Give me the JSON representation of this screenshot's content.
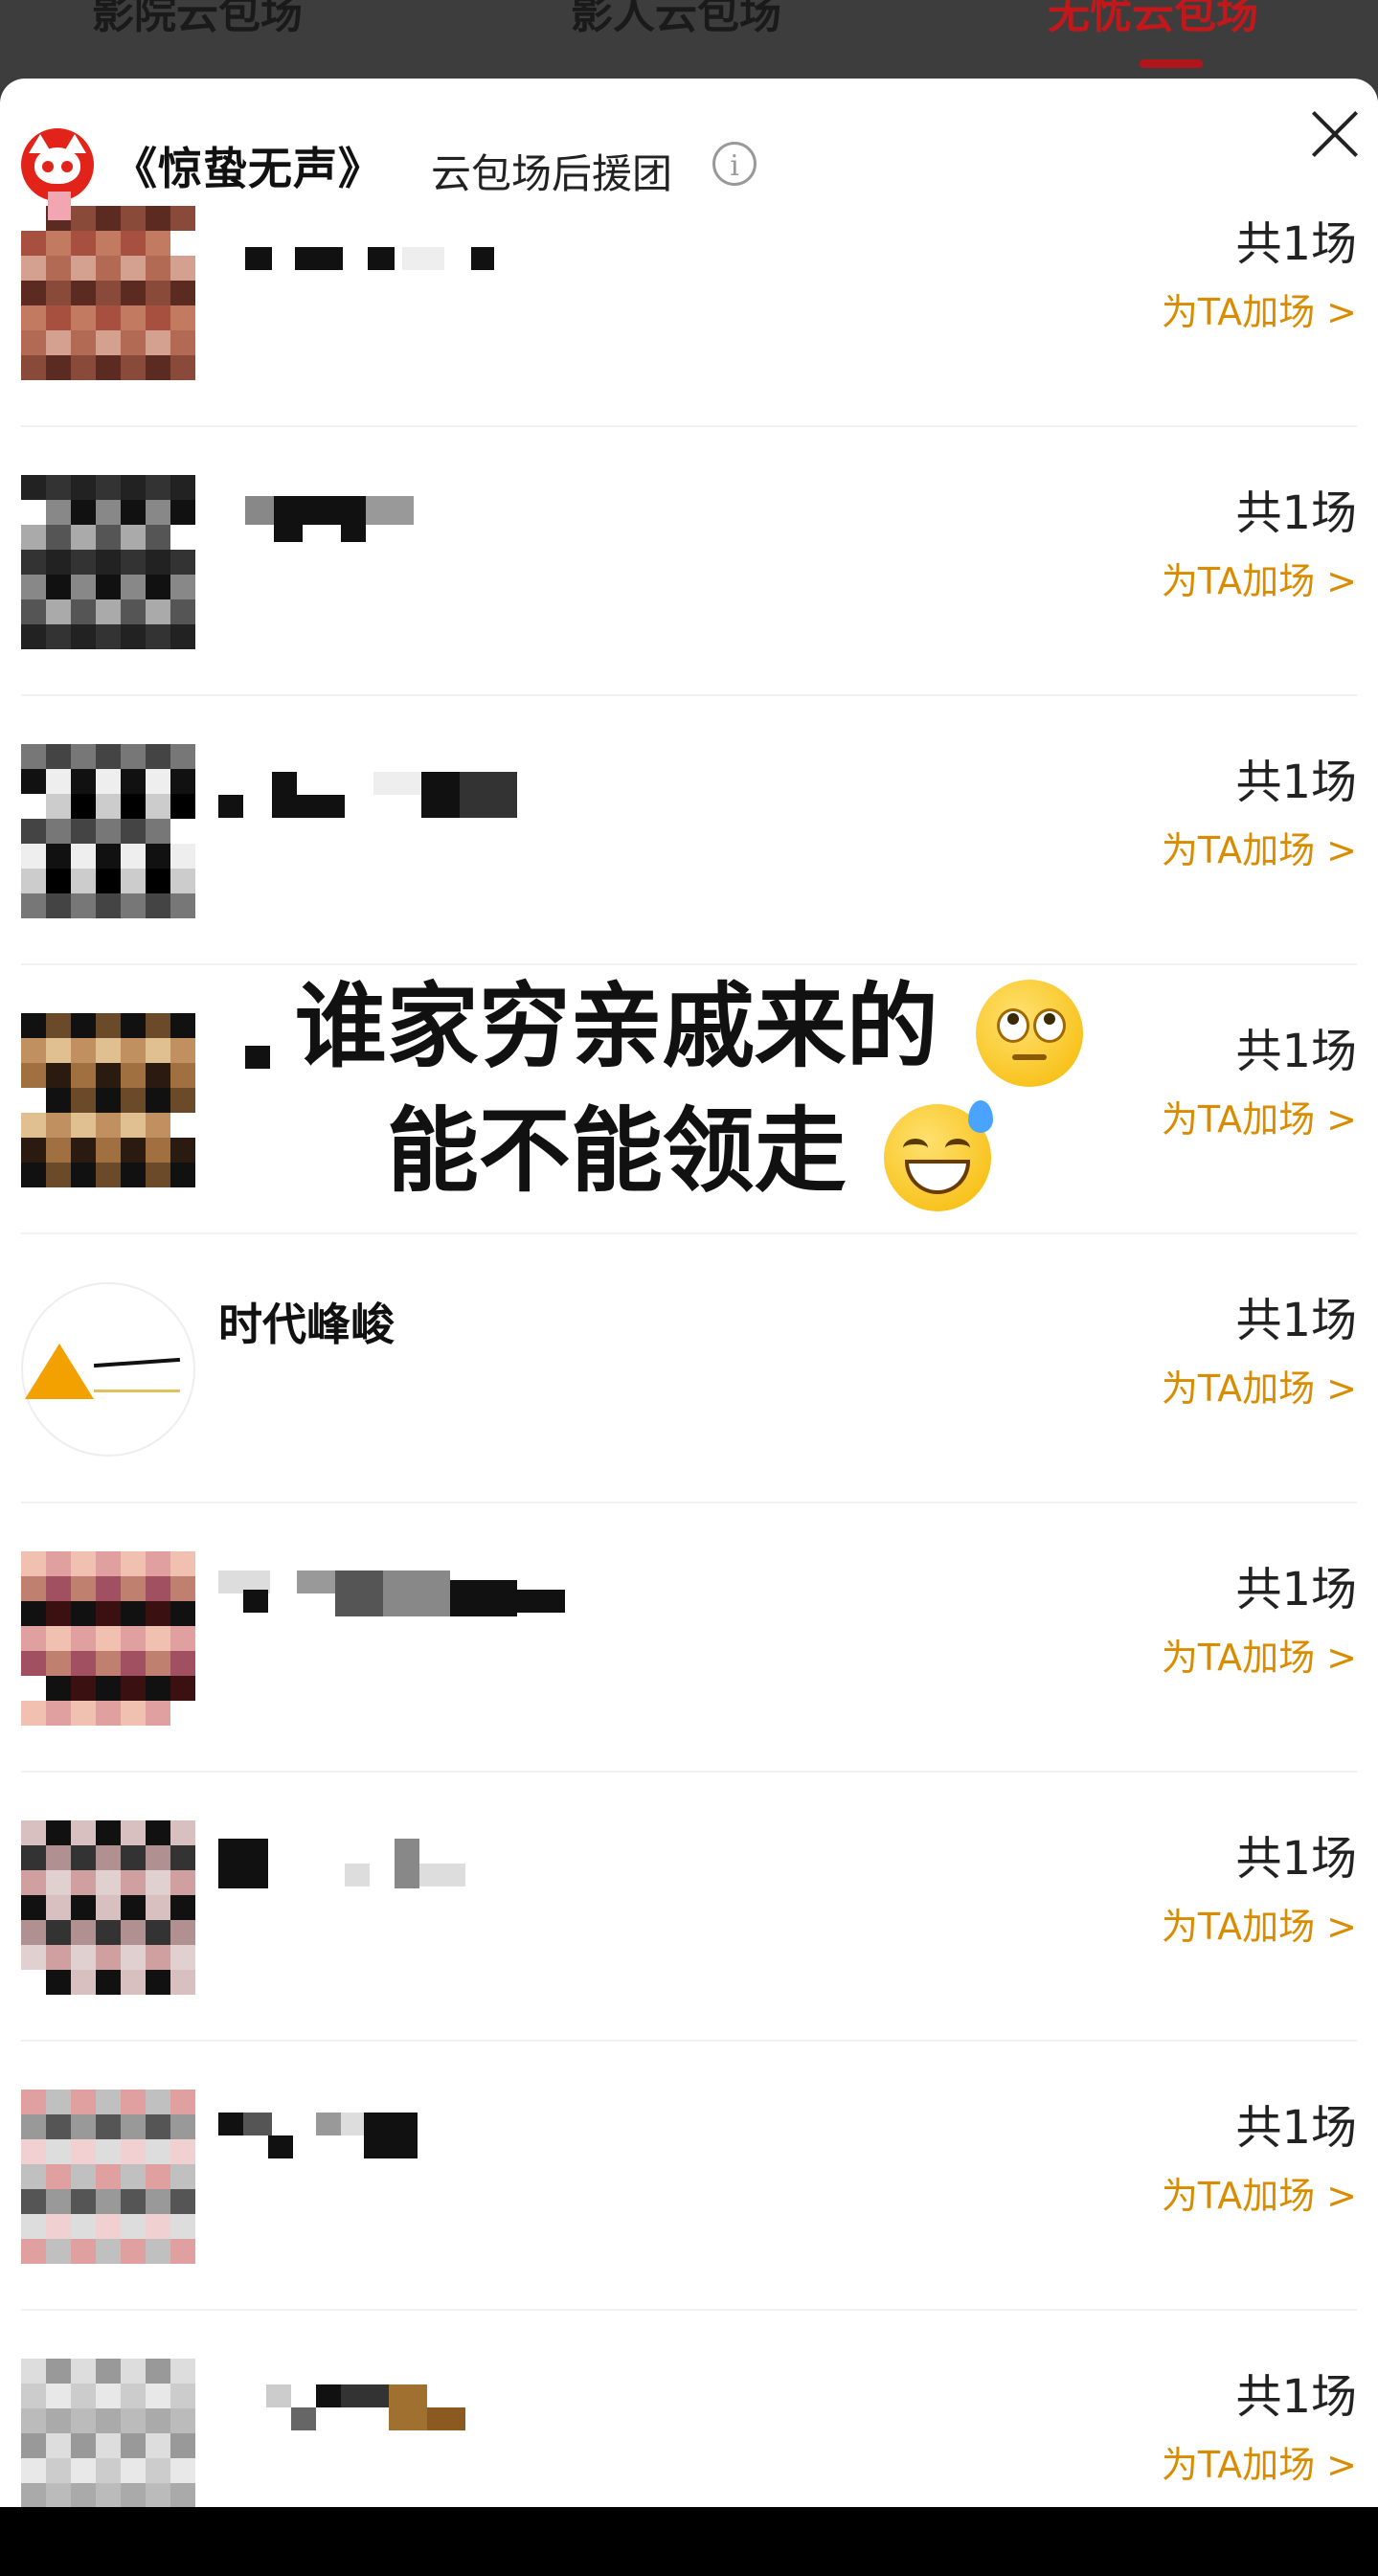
{
  "top_tabs": [
    {
      "label": "影院云包场",
      "active": false
    },
    {
      "label": "影人云包场",
      "active": false
    },
    {
      "label": "无忧云包场",
      "active": true
    }
  ],
  "sheet": {
    "title": "《惊蛰无声》",
    "subtitle": "云包场后援团",
    "info_icon": "info-icon",
    "close_icon": "close-icon"
  },
  "rows": [
    {
      "name": "",
      "count": "共1场",
      "action": "为TA加场 >",
      "avatar": "pixelated"
    },
    {
      "name": "",
      "count": "共1场",
      "action": "为TA加场 >",
      "avatar": "pixelated"
    },
    {
      "name": "",
      "count": "共1场",
      "action": "为TA加场 >",
      "avatar": "pixelated"
    },
    {
      "name": "",
      "count": "共1场",
      "action": "为TA加场 >",
      "avatar": "pixelated"
    },
    {
      "name": "时代峰峻",
      "count": "共1场",
      "action": "为TA加场 >",
      "avatar": "logo"
    },
    {
      "name": "",
      "count": "共1场",
      "action": "为TA加场 >",
      "avatar": "pixelated"
    },
    {
      "name": "",
      "count": "共1场",
      "action": "为TA加场 >",
      "avatar": "pixelated"
    },
    {
      "name": "",
      "count": "共1场",
      "action": "为TA加场 >",
      "avatar": "pixelated"
    },
    {
      "name": "",
      "count": "共1场",
      "action": "为TA加场 >",
      "avatar": "pixelated"
    }
  ],
  "caption": {
    "line1": "谁家穷亲戚来的",
    "line2": "能不能领走",
    "emoji1": "face-with-rolling-eyes",
    "emoji2": "grinning-face-with-sweat"
  },
  "colors": {
    "accent_orange": "#d98c00",
    "brand_red": "#e2231a",
    "active_tab_red": "#c0181b"
  }
}
